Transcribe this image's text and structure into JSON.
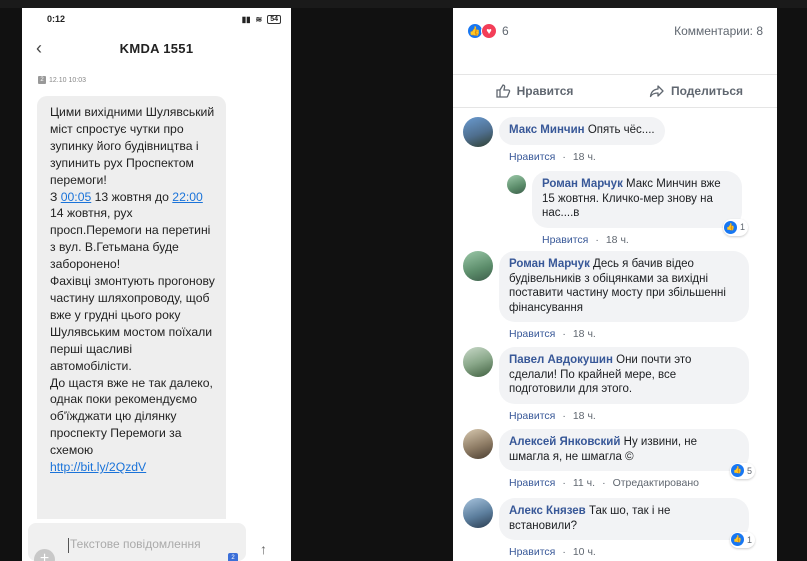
{
  "phone": {
    "status_time": "0:12",
    "battery": "54",
    "title": "KMDA 1551",
    "message_meta": "12.10 10:03",
    "message_parts": {
      "p1": "Цими вихідними Шулявський міст спростує чутки про зупинку його будівництва і зупинить рух Проспектом перемоги!",
      "p2a": "З ",
      "link1": "00:05",
      "p2b": " 13 жовтня до ",
      "link2": "22:00",
      "p2c": " 14 жовтня, рух просп.Перемоги на перетині з вул. В.Гетьмана буде заборонено!",
      "p3": "Фахівці змонтують прогонову частину шляхопроводу, щоб вже у грудні цього року Шулявським мостом поїхали перші щасливі автомобілісти.",
      "p4": "До щастя вже не так далеко, однак поки рекомендуємо об'їжджати цю ділянку проспекту Перемоги за схемою",
      "p5": "http://bit.ly/2QzdV"
    },
    "compose_placeholder": "Текстове повідомлення",
    "sim_badge": "2"
  },
  "fb": {
    "reactions_count": "6",
    "comments_label": "Комментарии: 8",
    "like_action": "Нравится",
    "share_action": "Поделиться",
    "comments": [
      {
        "author": "Макс Минчин",
        "text": "Опять чёс....",
        "like": "Нравится",
        "time": "18 ч.",
        "reactions": ""
      },
      {
        "author": "Роман Марчук",
        "text": "Макс Минчин вже 15 жовтня. Кличко-мер знову на нас....в",
        "like": "Нравится",
        "time": "18 ч.",
        "reactions": "1"
      },
      {
        "author": "Роман Марчук",
        "text": "Десь я бачив відео будівельників з обіцянками за вихідні поставити частину мосту при збільшенні фінансування",
        "like": "Нравится",
        "time": "18 ч.",
        "reactions": ""
      },
      {
        "author": "Павел Авдокушин",
        "text": "Они почти это сделали! По крайней мере, все подготовили для этого.",
        "like": "Нравится",
        "time": "18 ч.",
        "reactions": ""
      },
      {
        "author": "Алексей Янковский",
        "text": "Ну извини, не шмагла я, не шмагла ©",
        "like": "Нравится",
        "time": "11 ч.",
        "edited": "Отредактировано",
        "reactions": "5"
      },
      {
        "author": "Алекс Князев",
        "text": "Так шо, так і не встановили?",
        "like": "Нравится",
        "time": "10 ч.",
        "reactions": "1"
      }
    ]
  },
  "colors": {
    "fb_blue": "#1877f2",
    "fb_link": "#385898",
    "sms_link": "#1a73d9"
  }
}
